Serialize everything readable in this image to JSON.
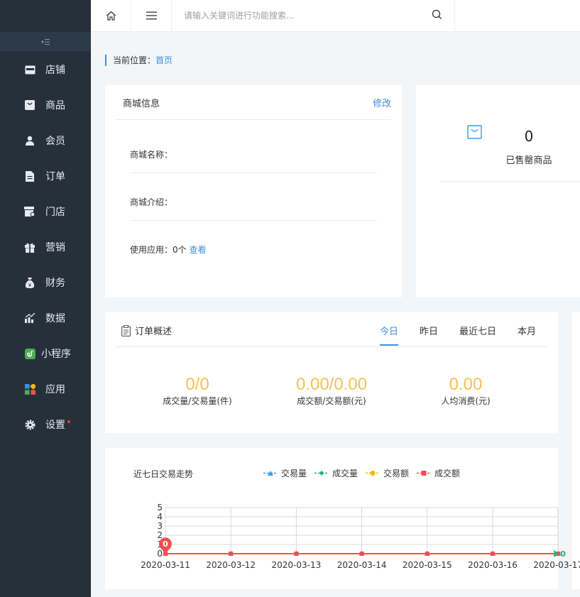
{
  "search": {
    "placeholder": "请输入关键词进行功能搜索..."
  },
  "sidebar": {
    "collapse_icon": "collapse-icon",
    "items": [
      {
        "label": "店铺",
        "icon": "store-icon"
      },
      {
        "label": "商品",
        "icon": "goods-icon"
      },
      {
        "label": "会员",
        "icon": "member-icon"
      },
      {
        "label": "订单",
        "icon": "order-icon"
      },
      {
        "label": "门店",
        "icon": "shop-icon"
      },
      {
        "label": "营销",
        "icon": "gift-icon"
      },
      {
        "label": "财务",
        "icon": "money-bag-icon"
      },
      {
        "label": "数据",
        "icon": "chart-icon"
      },
      {
        "label": "小程序",
        "icon": "miniprogram-icon"
      },
      {
        "label": "应用",
        "icon": "apps-icon"
      },
      {
        "label": "设置",
        "icon": "gear-icon",
        "badge_dot": true
      }
    ]
  },
  "breadcrumb": {
    "prefix": "当前位置：",
    "current": "首页"
  },
  "mall_info": {
    "title": "商城信息",
    "edit": "修改",
    "name_label": "商城名称：",
    "intro_label": "商城介绍：",
    "apps_label": "使用应用：",
    "apps_count": "0个",
    "apps_link": "查看"
  },
  "stats": {
    "sold_out_count": "0",
    "sold_out_label": "已售罄商品"
  },
  "order_overview": {
    "title": "订单概述",
    "tabs": [
      "今日",
      "昨日",
      "最近七日",
      "本月"
    ],
    "active_tab": "今日",
    "metrics": [
      {
        "value": "0/0",
        "label": "成交量/交易量(件)"
      },
      {
        "value": "0.00/0.00",
        "label": "成交额/交易额(元)"
      },
      {
        "value": "0.00",
        "label": "人均消费(元)"
      }
    ]
  },
  "chart_data": {
    "type": "line",
    "title": "近七日交易走势",
    "x": [
      "2020-03-11",
      "2020-03-12",
      "2020-03-13",
      "2020-03-14",
      "2020-03-15",
      "2020-03-16",
      "2020-03-17"
    ],
    "ylim": [
      0,
      5
    ],
    "yticks": [
      0,
      1,
      2,
      3,
      4,
      5
    ],
    "grid": true,
    "legend_position": "top",
    "series": [
      {
        "name": "交易量",
        "values": [
          0,
          0,
          0,
          0,
          0,
          0,
          0
        ],
        "color": "#3a9be6",
        "marker": "triangle"
      },
      {
        "name": "成交量",
        "values": [
          0,
          0,
          0,
          0,
          0,
          0,
          0
        ],
        "color": "#2eaf7d",
        "marker": "diamond"
      },
      {
        "name": "交易额",
        "values": [
          0,
          0,
          0,
          0,
          0,
          0,
          0
        ],
        "color": "#f5b800",
        "marker": "circle"
      },
      {
        "name": "成交额",
        "values": [
          0,
          0,
          0,
          0,
          0,
          0,
          0
        ],
        "color": "#f05050",
        "marker": "square"
      }
    ],
    "annotations": [
      {
        "text": "0",
        "at": "2020-03-11",
        "color": "#f05050"
      },
      {
        "text": "0",
        "at": "2020-03-17",
        "color": "#2eaf7d"
      }
    ]
  }
}
